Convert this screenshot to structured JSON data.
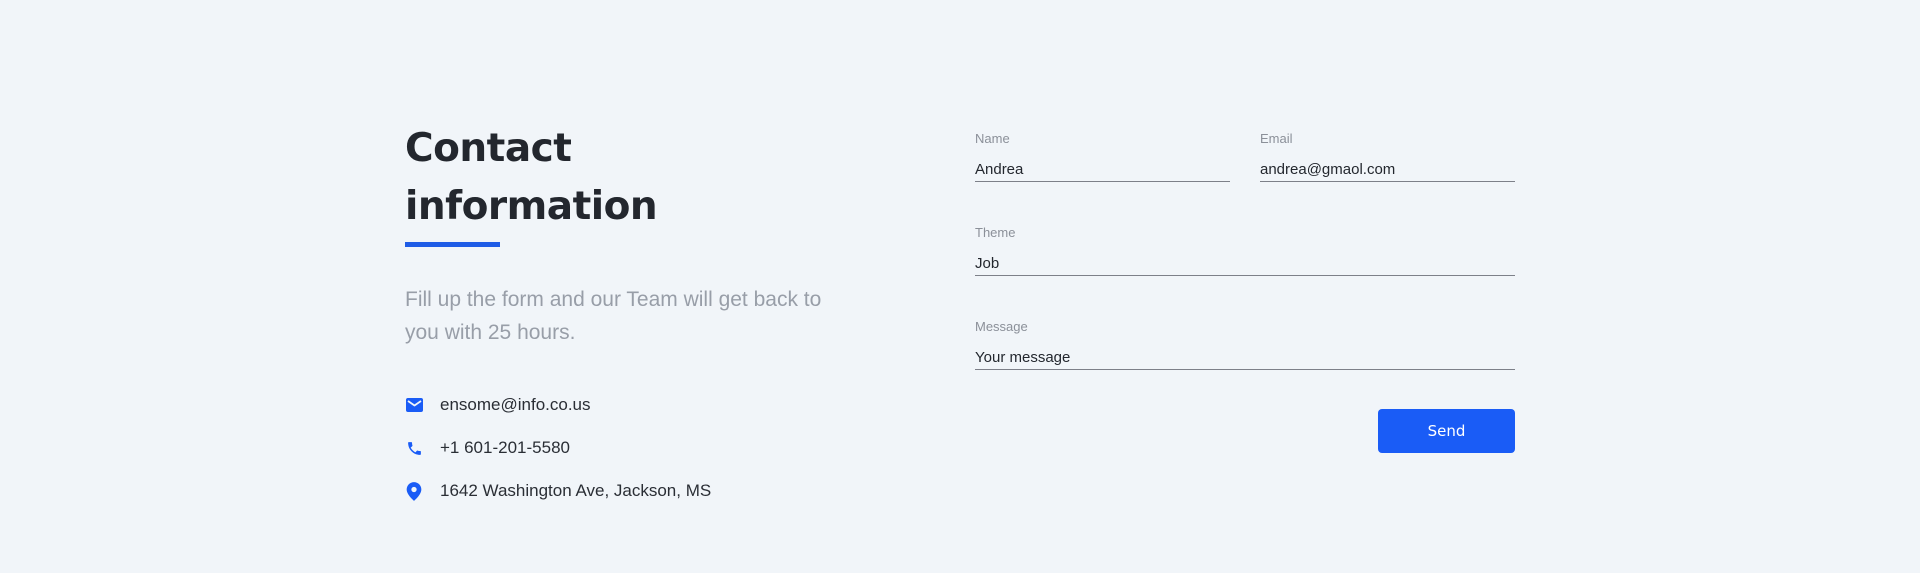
{
  "contact_info": {
    "title": "Contact information",
    "subtitle": "Fill up the form and our Team will get back to you with 25 hours.",
    "items": [
      {
        "icon": "mail-icon",
        "text": "ensome@info.co.us"
      },
      {
        "icon": "phone-icon",
        "text": "+1 601-201-5580"
      },
      {
        "icon": "location-pin-icon",
        "text": "1642 Washington Ave, Jackson, MS"
      }
    ]
  },
  "form": {
    "name": {
      "label": "Name",
      "value": "Andrea"
    },
    "email": {
      "label": "Email",
      "value": "andrea@gmaol.com"
    },
    "theme": {
      "label": "Theme",
      "value": "Job"
    },
    "message": {
      "label": "Message",
      "placeholder": "Your message"
    },
    "send_label": "Send"
  },
  "colors": {
    "accent": "#1a5cf6",
    "background": "#f1f5f9",
    "heading": "#23272e",
    "muted_text": "#989ea8"
  }
}
